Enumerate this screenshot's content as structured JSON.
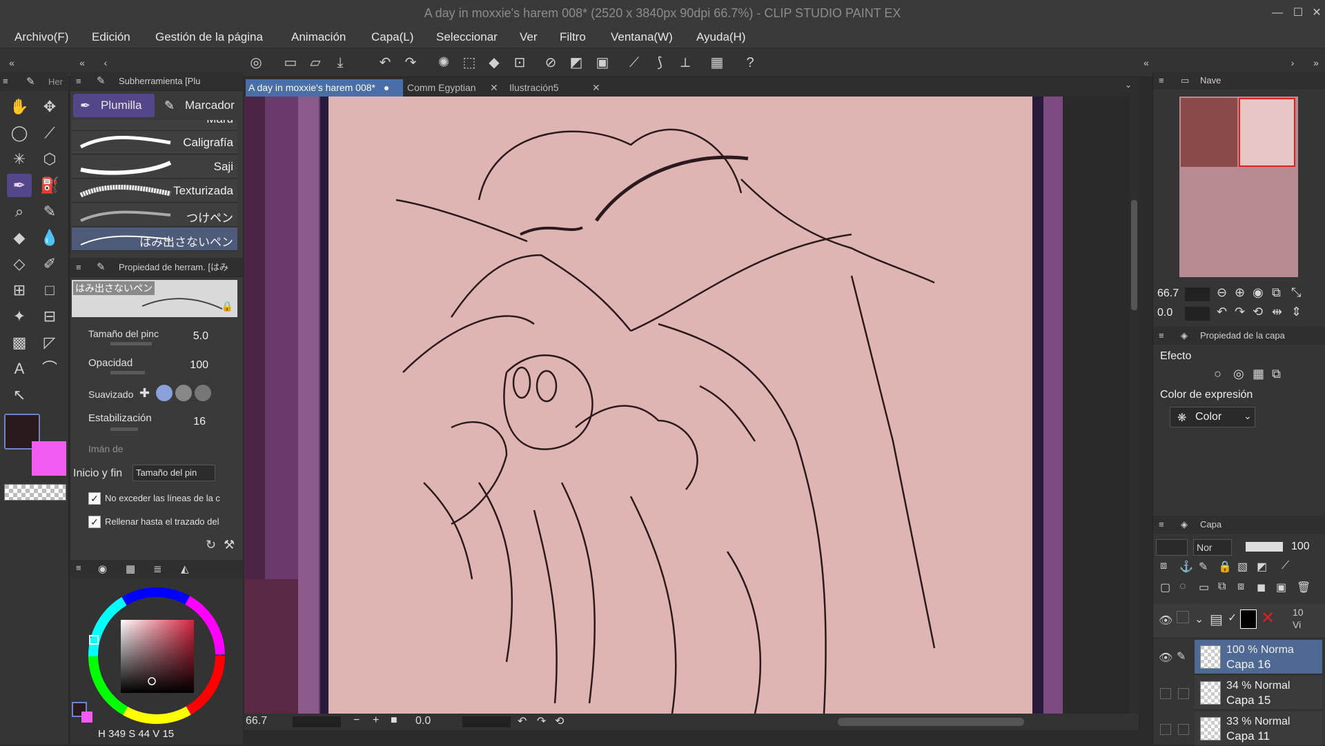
{
  "window": {
    "title": "A day in moxxie's harem 008* (2520 x 3840px 90dpi 66.7%) - CLIP STUDIO PAINT EX",
    "minimize": "—",
    "maximize": "☐",
    "close": "✕"
  },
  "menu": [
    "Archivo(F)",
    "Edición",
    "Gestión de la página",
    "Animación",
    "Capa(L)",
    "Seleccionar",
    "Ver",
    "Filtro",
    "Ventana(W)",
    "Ayuda(H)"
  ],
  "tool_panel": {
    "tab_label": "Her"
  },
  "subtool": {
    "header": "Subherramienta [Plu",
    "tabs": [
      "Plumilla",
      "Marcador"
    ],
    "brushes": [
      "Maru",
      "Caligrafía",
      "Saji",
      "Texturizada",
      "つけペン",
      "はみ出さないペン"
    ],
    "selected_brush": "はみ出さないペン"
  },
  "tool_property": {
    "header": "Propiedad de herram. [はみ",
    "preview_label": "はみ出さないペン",
    "brush_size_label": "Tamaño del pinc",
    "brush_size_value": "5.0",
    "opacity_label": "Opacidad",
    "opacity_value": "100",
    "smoothing_label": "Suavizado",
    "stabilization_label": "Estabilización",
    "stabilization_value": "16",
    "snap_label": "Imán de",
    "start_end_label": "Inicio y fin",
    "start_end_value": "Tamaño del pin",
    "option1_label": "No exceder las líneas de la c",
    "option2_label": "Rellenar hasta el trazado del"
  },
  "color_panel": {
    "main_color": "#2a1a1e",
    "sub_color": "#f25cf0",
    "hsv_h": "349",
    "hsv_s": "44",
    "hsv_v": "15",
    "h_label": "H",
    "s_label": "S",
    "v_label": "V"
  },
  "document_tabs": [
    {
      "label": "A day in moxxie's harem 008*",
      "active": true
    },
    {
      "label": "Comm Egyptian",
      "active": false
    },
    {
      "label": "Ilustración5",
      "active": false
    }
  ],
  "status": {
    "zoom": "66.7",
    "angle": "0.0"
  },
  "navigator": {
    "header": "Nave",
    "zoom": "66.7",
    "angle": "0.0"
  },
  "layer_property": {
    "header": "Propiedad de la capa",
    "effect_label": "Efecto",
    "expression_color_label": "Color de expresión",
    "expression_color_value": "Color"
  },
  "layers_panel": {
    "header": "Capa",
    "blend_mode": "Nor",
    "opacity": "100",
    "folder_opacity": "10",
    "folder_mode": "Vi",
    "layers": [
      {
        "opacity_mode": "100 % Norma",
        "name": "Capa 16",
        "selected": true
      },
      {
        "opacity_mode": "34 % Normal",
        "name": "Capa 15",
        "selected": false
      },
      {
        "opacity_mode": "33 % Normal",
        "name": "Capa 11",
        "selected": false
      }
    ]
  },
  "colors": {
    "canvas_paper": "#dfb5b3",
    "accent": "#55468a",
    "tab_active": "#4a6fa8",
    "layer_selected": "#4e6a94"
  }
}
